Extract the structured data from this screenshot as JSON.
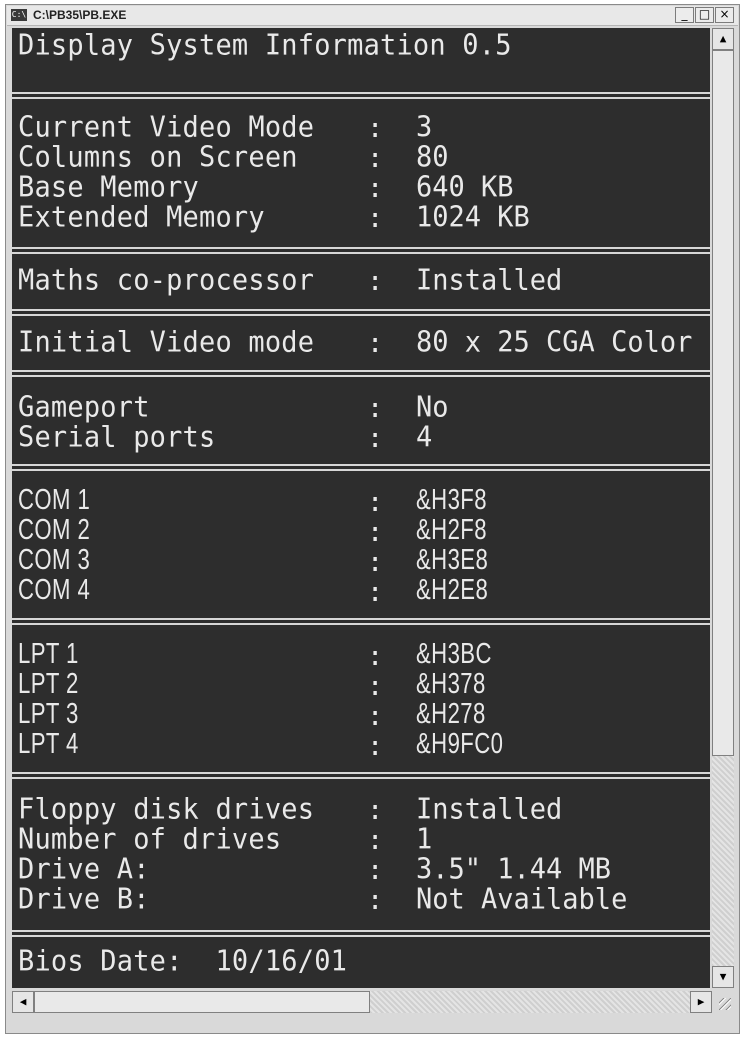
{
  "window": {
    "title": "C:\\PB35\\PB.EXE",
    "icon_text": "C:\\",
    "minimize_icon": "_",
    "maximize_icon": "□",
    "close_icon": "×"
  },
  "console": {
    "heading": "Display System Information 0.5",
    "colon": ":",
    "video": {
      "rows": [
        {
          "label": "Current Video Mode",
          "value": "3"
        },
        {
          "label": "Columns on Screen",
          "value": "80"
        },
        {
          "label": "Base Memory",
          "value": "640 KB"
        },
        {
          "label": "Extended Memory",
          "value": "1024 KB"
        }
      ]
    },
    "coprocessor": {
      "label": "Maths co-processor",
      "value": "Installed"
    },
    "initial_video": {
      "label": "Initial Video mode",
      "value": "80 x 25 CGA Color"
    },
    "ports": {
      "rows": [
        {
          "label": "Gameport",
          "value": "No"
        },
        {
          "label": "Serial ports",
          "value": "4"
        }
      ]
    },
    "com": {
      "rows": [
        {
          "label": "COM 1",
          "value": "&H3F8"
        },
        {
          "label": "COM 2",
          "value": "&H2F8"
        },
        {
          "label": "COM 3",
          "value": "&H3E8"
        },
        {
          "label": "COM 4",
          "value": "&H2E8"
        }
      ]
    },
    "lpt": {
      "rows": [
        {
          "label": "LPT 1",
          "value": "&H3BC"
        },
        {
          "label": "LPT 2",
          "value": "&H378"
        },
        {
          "label": "LPT 3",
          "value": "&H278"
        },
        {
          "label": "LPT 4",
          "value": "&H9FC0"
        }
      ]
    },
    "floppy": {
      "rows": [
        {
          "label": "Floppy disk drives",
          "value": "Installed"
        },
        {
          "label": "Number of drives",
          "value": "1"
        },
        {
          "label": "Drive A:",
          "value": "3.5\" 1.44 MB"
        },
        {
          "label": "Drive B:",
          "value": "Not Available"
        }
      ]
    },
    "bios": "Bios Date:  10/16/01"
  },
  "scrollbars": {
    "up_arrow": "▲",
    "down_arrow": "▼",
    "left_arrow": "◀",
    "right_arrow": "▶"
  }
}
